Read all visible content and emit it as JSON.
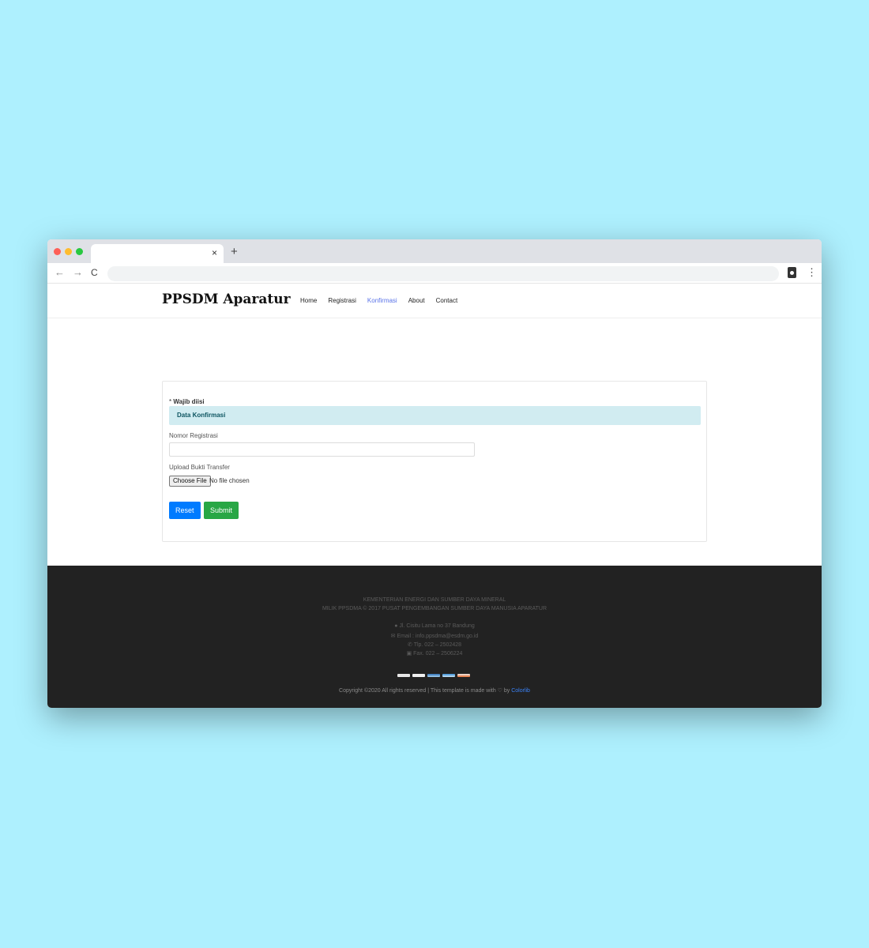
{
  "browser": {
    "tab_close": "×",
    "new_tab": "+",
    "back": "←",
    "forward": "→",
    "reload": "C",
    "menu": "⋮",
    "icons": [
      "close-icon",
      "plus-icon",
      "arrow-left-icon",
      "arrow-right-icon",
      "reload-icon",
      "clipboard-user-icon",
      "kebab-menu-icon"
    ]
  },
  "header": {
    "brand": "PPSDM Aparatur",
    "nav": [
      {
        "label": "Home"
      },
      {
        "label": "Registrasi"
      },
      {
        "label": "Konfirmasi",
        "active": true
      },
      {
        "label": "About"
      },
      {
        "label": "Contact"
      }
    ]
  },
  "form": {
    "required_star": "*",
    "required_text": "Wajib diisi",
    "section_title": "Data Konfirmasi",
    "registration_label": "Nomor Registrasi",
    "registration_value": "",
    "upload_label": "Upload Bukti Transfer",
    "file_button": "Choose File",
    "file_status": "No file chosen",
    "reset_label": "Reset",
    "submit_label": "Submit"
  },
  "footer": {
    "line1": "KEMENTERIAN ENERGI DAN SUMBER DAYA MINERAL",
    "line2": "MILIK PPSDMA © 2017 PUSAT PENGEMBANGAN SUMBER DAYA MANUSIA APARATUR",
    "address": "Jl. Cisitu Lama no 37 Bandung",
    "email": "Email : info.ppsdma@esdm.go.id",
    "phone": "Tlp. 022 – 2502428",
    "fax": "Fax. 022 – 2506224",
    "copyright_prefix": "Copyright ©2020 All rights reserved | This template is made with ♡ by",
    "copyright_link": "Colorlib",
    "payment_icons": [
      "visa-card-icon",
      "mastercard-icon",
      "paypal-icon",
      "amex-card-icon",
      "discover-card-icon"
    ],
    "colors": {
      "background": "#222222",
      "link": "#3b82f6"
    }
  },
  "colors": {
    "page_background": "#aef0fe",
    "active_nav": "#5a73e8",
    "section_bar": "#d1ecf1",
    "reset_button": "#007bff",
    "submit_button": "#28a745"
  }
}
